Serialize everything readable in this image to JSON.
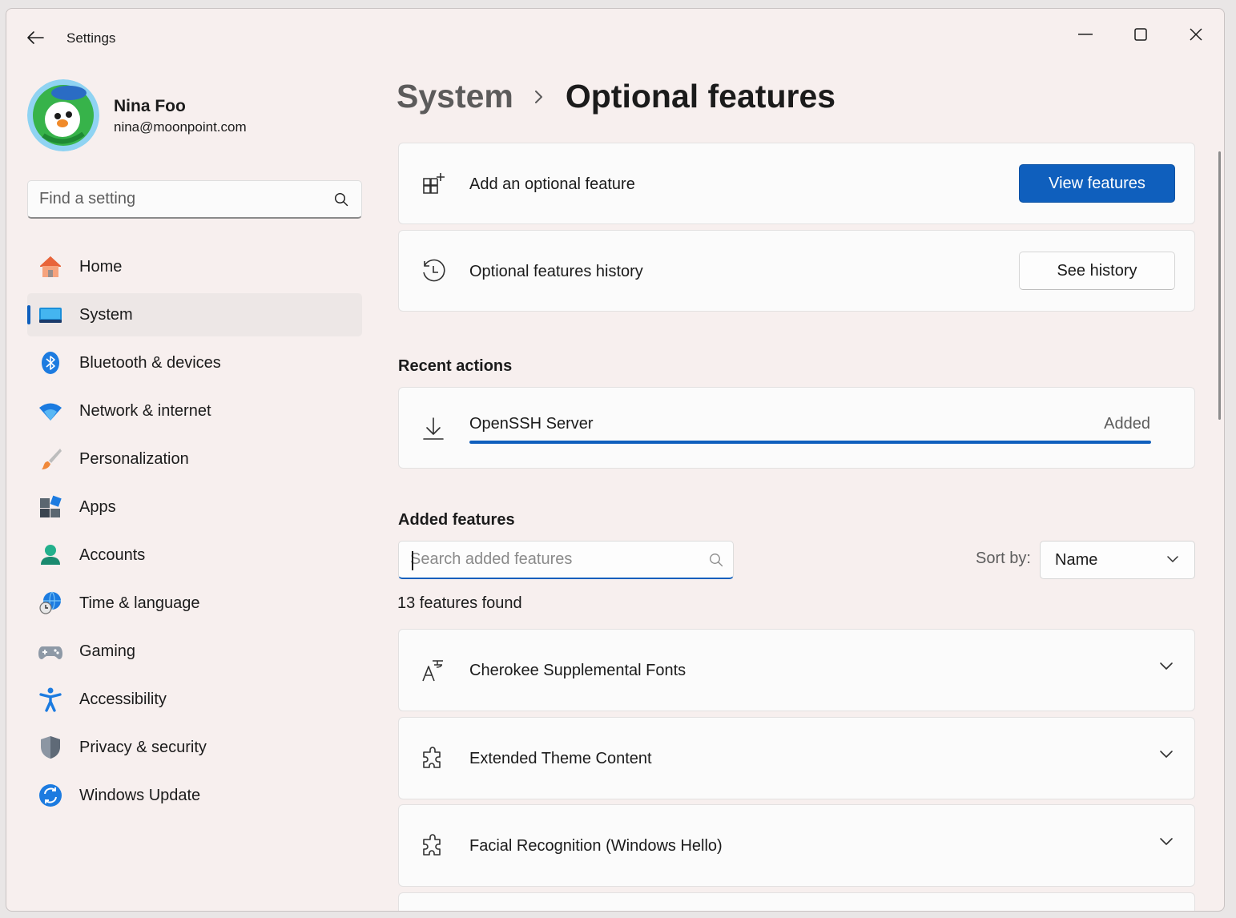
{
  "window": {
    "app_title": "Settings"
  },
  "profile": {
    "name": "Nina Foo",
    "email": "nina@moonpoint.com"
  },
  "search": {
    "placeholder": "Find a setting"
  },
  "nav": {
    "items": [
      {
        "label": "Home",
        "icon": "home-icon"
      },
      {
        "label": "System",
        "icon": "system-icon",
        "active": true
      },
      {
        "label": "Bluetooth & devices",
        "icon": "bluetooth-icon"
      },
      {
        "label": "Network & internet",
        "icon": "wifi-icon"
      },
      {
        "label": "Personalization",
        "icon": "brush-icon"
      },
      {
        "label": "Apps",
        "icon": "apps-icon"
      },
      {
        "label": "Accounts",
        "icon": "accounts-icon"
      },
      {
        "label": "Time & language",
        "icon": "globe-clock-icon"
      },
      {
        "label": "Gaming",
        "icon": "gamepad-icon"
      },
      {
        "label": "Accessibility",
        "icon": "accessibility-icon"
      },
      {
        "label": "Privacy & security",
        "icon": "shield-icon"
      },
      {
        "label": "Windows Update",
        "icon": "update-icon"
      }
    ]
  },
  "breadcrumb": {
    "parent": "System",
    "current": "Optional features"
  },
  "actions": {
    "add_label": "Add an optional feature",
    "add_button": "View features",
    "history_label": "Optional features history",
    "history_button": "See history"
  },
  "recent": {
    "title": "Recent actions",
    "item_name": "OpenSSH Server",
    "item_status": "Added",
    "progress": 1.0
  },
  "added": {
    "title": "Added features",
    "search_placeholder": "Search added features",
    "sort_label": "Sort by:",
    "sort_value": "Name",
    "count_text": "13 features found",
    "features": [
      {
        "name": "Cherokee Supplemental Fonts",
        "icon": "font-icon"
      },
      {
        "name": "Extended Theme Content",
        "icon": "puzzle-icon"
      },
      {
        "name": "Facial Recognition (Windows Hello)",
        "icon": "puzzle-icon"
      }
    ]
  },
  "colors": {
    "accent": "#0f5fbd",
    "window_bg": "#f7efee",
    "card_bg": "#fbfbfb"
  }
}
